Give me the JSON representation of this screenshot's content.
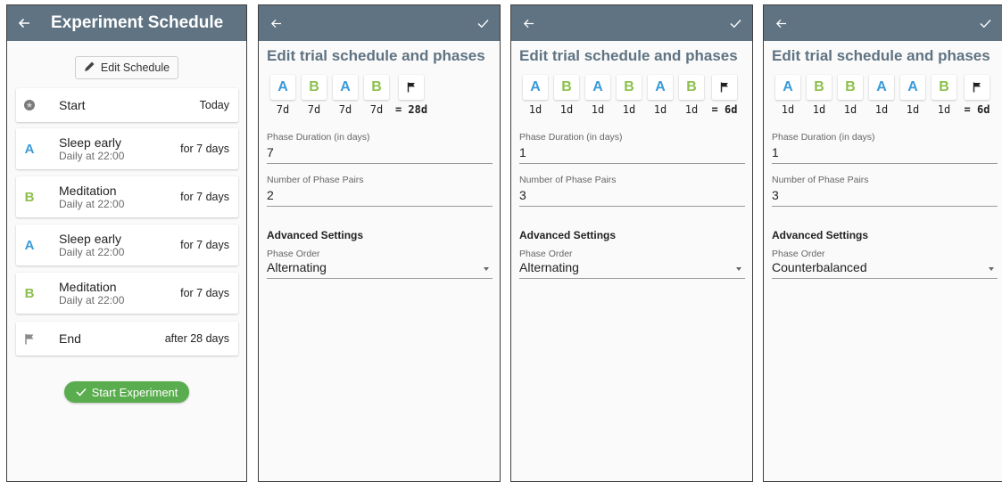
{
  "schedule_screen": {
    "title": "Experiment Schedule",
    "edit_button_label": "Edit Schedule",
    "items": [
      {
        "lead": "start-icon",
        "title": "Start",
        "subtitle": "",
        "trail": "Today"
      },
      {
        "lead": "A",
        "title": "Sleep early",
        "subtitle": "Daily at 22:00",
        "trail": "for 7 days"
      },
      {
        "lead": "B",
        "title": "Meditation",
        "subtitle": "Daily at 22:00",
        "trail": "for 7 days"
      },
      {
        "lead": "A",
        "title": "Sleep early",
        "subtitle": "Daily at 22:00",
        "trail": "for 7 days"
      },
      {
        "lead": "B",
        "title": "Meditation",
        "subtitle": "Daily at 22:00",
        "trail": "for 7 days"
      },
      {
        "lead": "flag-icon",
        "title": "End",
        "subtitle": "",
        "trail": "after 28 days"
      }
    ],
    "start_button_label": "Start Experiment",
    "colors": {
      "appbar": "#5f7382",
      "phase_a": "#3a9bd9",
      "phase_b": "#8cc04c",
      "start_button": "#5aad4e"
    }
  },
  "edit_screens": [
    {
      "heading": "Edit trial schedule and phases",
      "phases": [
        {
          "letter": "A",
          "dur": "7d"
        },
        {
          "letter": "B",
          "dur": "7d"
        },
        {
          "letter": "A",
          "dur": "7d"
        },
        {
          "letter": "B",
          "dur": "7d"
        }
      ],
      "total": "= 28d",
      "duration_label": "Phase Duration (in days)",
      "duration_value": "7",
      "pairs_label": "Number of Phase Pairs",
      "pairs_value": "2",
      "advanced_label": "Advanced Settings",
      "order_label": "Phase Order",
      "order_value": "Alternating"
    },
    {
      "heading": "Edit trial schedule and phases",
      "phases": [
        {
          "letter": "A",
          "dur": "1d"
        },
        {
          "letter": "B",
          "dur": "1d"
        },
        {
          "letter": "A",
          "dur": "1d"
        },
        {
          "letter": "B",
          "dur": "1d"
        },
        {
          "letter": "A",
          "dur": "1d"
        },
        {
          "letter": "B",
          "dur": "1d"
        }
      ],
      "total": "= 6d",
      "duration_label": "Phase Duration (in days)",
      "duration_value": "1",
      "pairs_label": "Number of Phase Pairs",
      "pairs_value": "3",
      "advanced_label": "Advanced Settings",
      "order_label": "Phase Order",
      "order_value": "Alternating"
    },
    {
      "heading": "Edit trial schedule and phases",
      "phases": [
        {
          "letter": "A",
          "dur": "1d"
        },
        {
          "letter": "B",
          "dur": "1d"
        },
        {
          "letter": "B",
          "dur": "1d"
        },
        {
          "letter": "A",
          "dur": "1d"
        },
        {
          "letter": "A",
          "dur": "1d"
        },
        {
          "letter": "B",
          "dur": "1d"
        }
      ],
      "total": "= 6d",
      "duration_label": "Phase Duration (in days)",
      "duration_value": "1",
      "pairs_label": "Number of Phase Pairs",
      "pairs_value": "3",
      "advanced_label": "Advanced Settings",
      "order_label": "Phase Order",
      "order_value": "Counterbalanced"
    }
  ]
}
